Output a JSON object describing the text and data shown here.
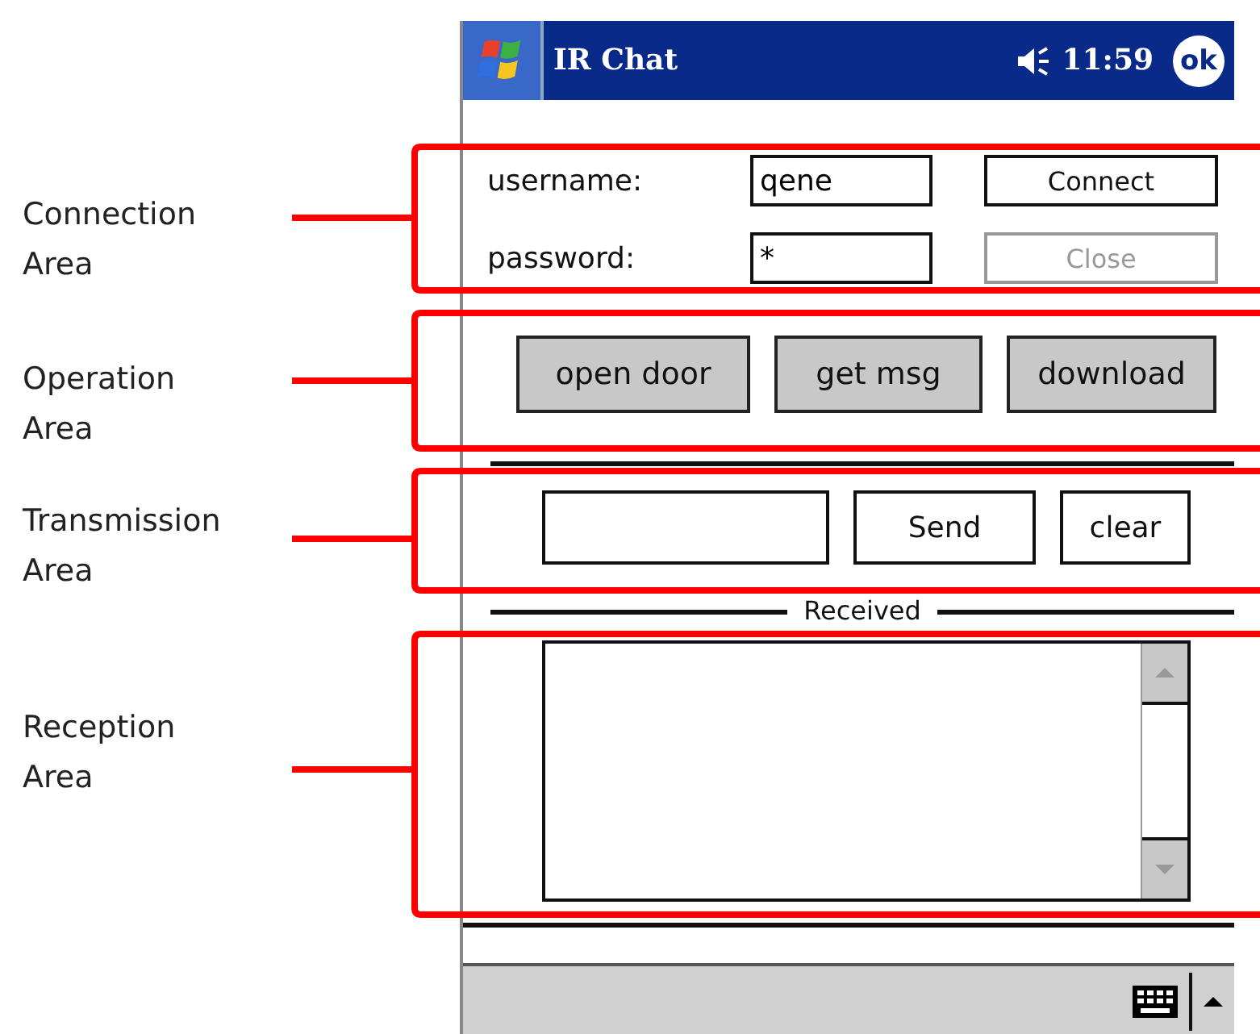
{
  "annotations": [
    {
      "lines": [
        "Connection",
        "Area"
      ]
    },
    {
      "lines": [
        "Operation",
        "Area"
      ]
    },
    {
      "lines": [
        "Transmission",
        "Area"
      ]
    },
    {
      "lines": [
        "Reception",
        "Area"
      ]
    }
  ],
  "window": {
    "title": "IR Chat",
    "time": "11:59",
    "ok": "ok"
  },
  "connection": {
    "fields": [
      {
        "label": "username:",
        "value": "qene"
      },
      {
        "label": "password:",
        "value": "*"
      }
    ],
    "buttons": [
      {
        "label": "Connect",
        "disabled": false
      },
      {
        "label": "Close",
        "disabled": true
      }
    ]
  },
  "operations": [
    "open door",
    "get msg",
    "download"
  ],
  "transmission": {
    "buttons": [
      "Send",
      "clear"
    ]
  },
  "reception": {
    "group_label": "Received"
  }
}
